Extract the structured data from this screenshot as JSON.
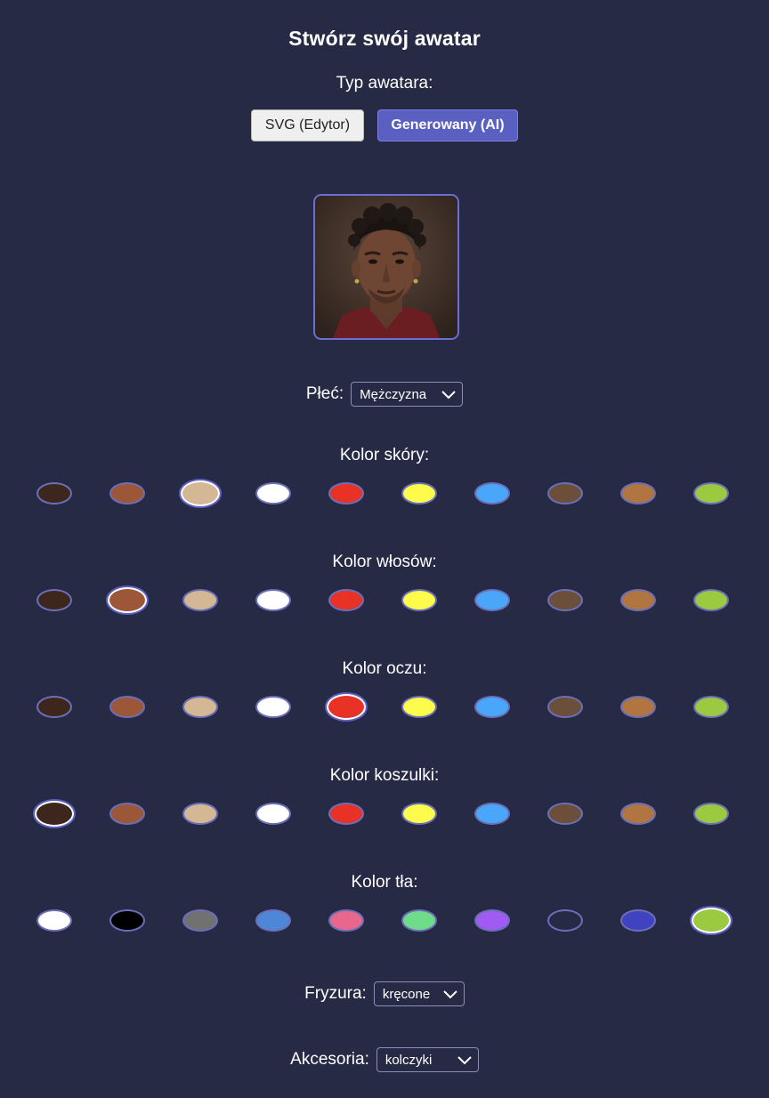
{
  "title": "Stwórz swój awatar",
  "avatar_type": {
    "label": "Typ awatara:",
    "options": [
      "SVG (Edytor)",
      "Generowany (AI)"
    ],
    "selected": "Generowany (AI)"
  },
  "gender": {
    "label": "Płeć:",
    "value": "Mężczyzna"
  },
  "skin": {
    "label": "Kolor skóry:",
    "colors": [
      "#3d271d",
      "#9c5638",
      "#d4b896",
      "#ffffff",
      "#e83226",
      "#fdfc4c",
      "#4aa6f8",
      "#6b4f3a",
      "#b07540",
      "#9bca40"
    ],
    "selected_index": 2
  },
  "hair": {
    "label": "Kolor włosów:",
    "colors": [
      "#3d271d",
      "#9c5638",
      "#d4b896",
      "#ffffff",
      "#e83226",
      "#fdfc4c",
      "#4aa6f8",
      "#6b4f3a",
      "#b07540",
      "#9bca40"
    ],
    "selected_index": 1
  },
  "eyes": {
    "label": "Kolor oczu:",
    "colors": [
      "#3d271d",
      "#9c5638",
      "#d4b896",
      "#ffffff",
      "#e83226",
      "#fdfc4c",
      "#4aa6f8",
      "#6b4f3a",
      "#b07540",
      "#9bca40"
    ],
    "selected_index": 4
  },
  "shirt": {
    "label": "Kolor koszulki:",
    "colors": [
      "#3d271d",
      "#9c5638",
      "#d4b896",
      "#ffffff",
      "#e83226",
      "#fdfc4c",
      "#4aa6f8",
      "#6b4f3a",
      "#b07540",
      "#9bca40"
    ],
    "selected_index": 0
  },
  "background": {
    "label": "Kolor tła:",
    "colors": [
      "#ffffff",
      "#000000",
      "#717171",
      "#4f87d8",
      "#e8678c",
      "#6fdc8c",
      "#a05cf2",
      "#262a45",
      "#3f43bf",
      "#9bca40"
    ],
    "selected_index": 9
  },
  "hairstyle": {
    "label": "Fryzura:",
    "value": "kręcone"
  },
  "accessories": {
    "label": "Akcesoria:",
    "value": "kolczyki"
  },
  "colors": {
    "accent": "#5a5fc2",
    "page_bg": "#262a45"
  }
}
